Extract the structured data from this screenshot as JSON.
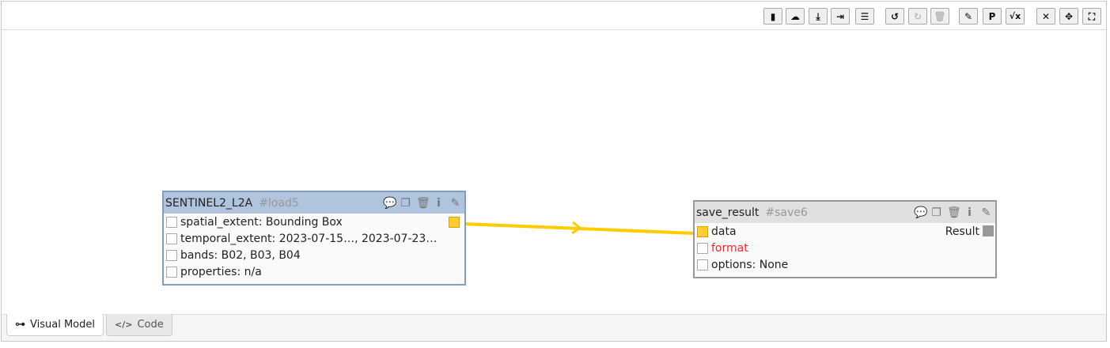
{
  "toolbar": {
    "buttons": [
      {
        "name": "new-icon",
        "glyph": "▮"
      },
      {
        "name": "cloud-download-icon",
        "glyph": "☁"
      },
      {
        "name": "file-import-icon",
        "glyph": "⤓"
      },
      {
        "name": "file-export-icon",
        "glyph": "⇥"
      },
      {
        "name": "tasks-icon",
        "glyph": "☰"
      },
      {
        "name": "undo-icon",
        "glyph": "↺"
      },
      {
        "name": "redo-icon",
        "glyph": "↻"
      },
      {
        "name": "trash-icon",
        "glyph": "🗑"
      },
      {
        "name": "edit-icon",
        "glyph": "✎"
      },
      {
        "name": "parameter-icon",
        "glyph": "P"
      },
      {
        "name": "formula-icon",
        "glyph": "√x"
      },
      {
        "name": "compress-icon",
        "glyph": "✕"
      },
      {
        "name": "move-icon",
        "glyph": "✥"
      },
      {
        "name": "fullscreen-icon",
        "glyph": "⛶"
      }
    ]
  },
  "nodes": [
    {
      "title": "SENTINEL2_L2A",
      "id": "#load5",
      "params": [
        "spatial_extent: Bounding Box",
        "temporal_extent: 2023-07-15…, 2023-07-23…",
        "bands: B02, B03, B04",
        "properties: n/a"
      ]
    },
    {
      "title": "save_result",
      "id": "#save6",
      "params": [
        "data",
        "format",
        "options: None"
      ],
      "output": "Result"
    }
  ],
  "node_icons": {
    "comment": "💬",
    "clone": "❐",
    "delete": "🗑",
    "info": "i",
    "edit": "✎"
  },
  "colors": {
    "edge": "#ffcc00",
    "load_header": "#b0c4de",
    "save_header": "#e0e0e0",
    "required_param": "#ff2222"
  },
  "tabs": {
    "visual_model": "Visual Model",
    "code": "Code",
    "visual_icon": "⊶",
    "code_icon": "</>"
  }
}
